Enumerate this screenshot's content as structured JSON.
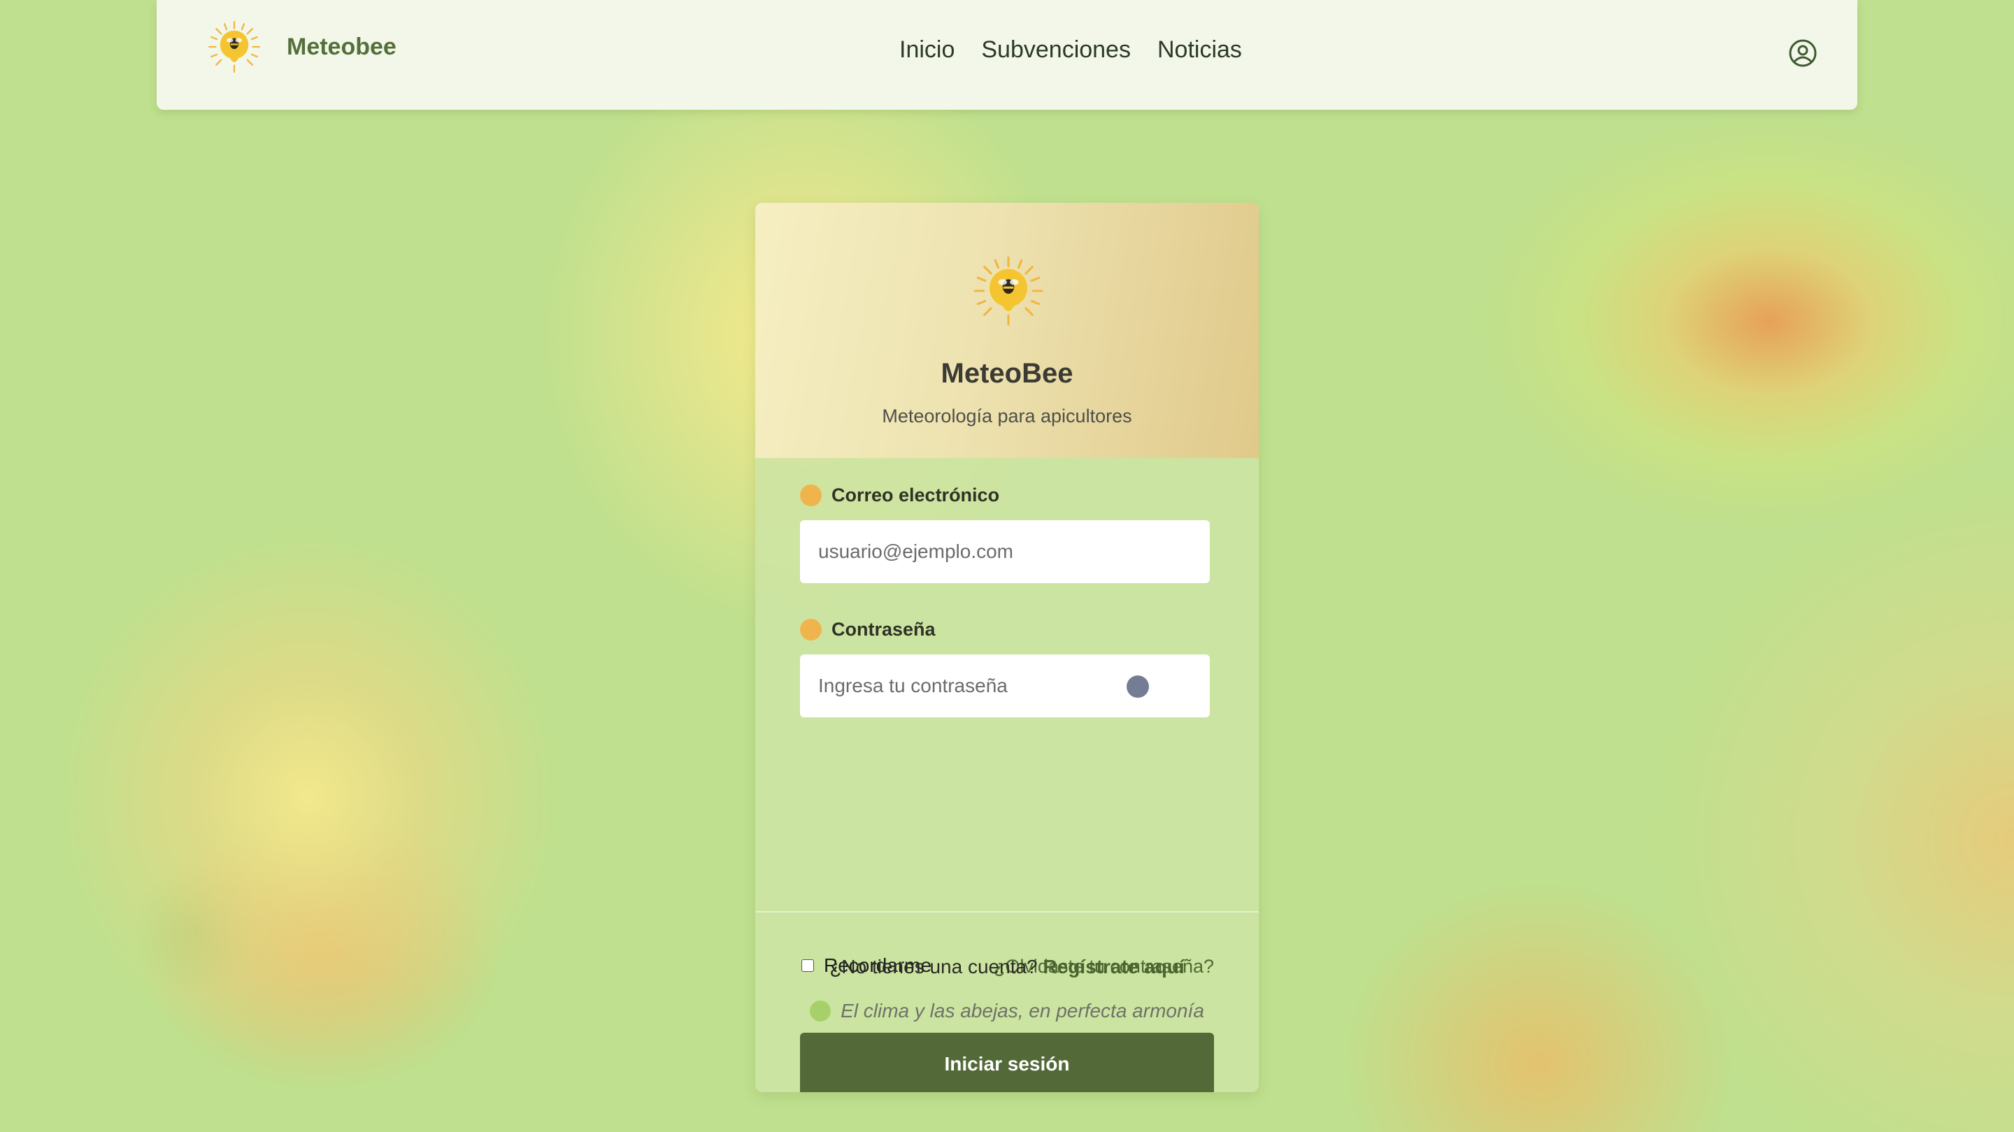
{
  "navbar": {
    "brand_name": "Meteobee",
    "links": [
      "Inicio",
      "Subvenciones",
      "Noticias"
    ],
    "icons": {
      "logo": "sun-bee-logo",
      "user": "user-circle-icon"
    }
  },
  "card": {
    "title": "MeteoBee",
    "subtitle": "Meteorología para apicultores",
    "email_label": "Correo electrónico",
    "email_placeholder": "usuario@ejemplo.com",
    "password_label": "Contraseña",
    "password_placeholder": "Ingresa tu contraseña",
    "remember_label": "Recordarme",
    "forgot_link": "¿Olvidaste tu contraseña?",
    "submit_label": "Iniciar sesión",
    "register_prompt": "¿No tienes una cuenta?",
    "register_link": "Regístrate aquí",
    "tagline": "El clima y las abejas, en perfecta armonía"
  },
  "colors": {
    "background": "#bfe08e",
    "primary": "#536a38",
    "accent_dot": "#f0b44c",
    "eye_dot": "#757d95",
    "tag_dot": "#a8d06a"
  }
}
